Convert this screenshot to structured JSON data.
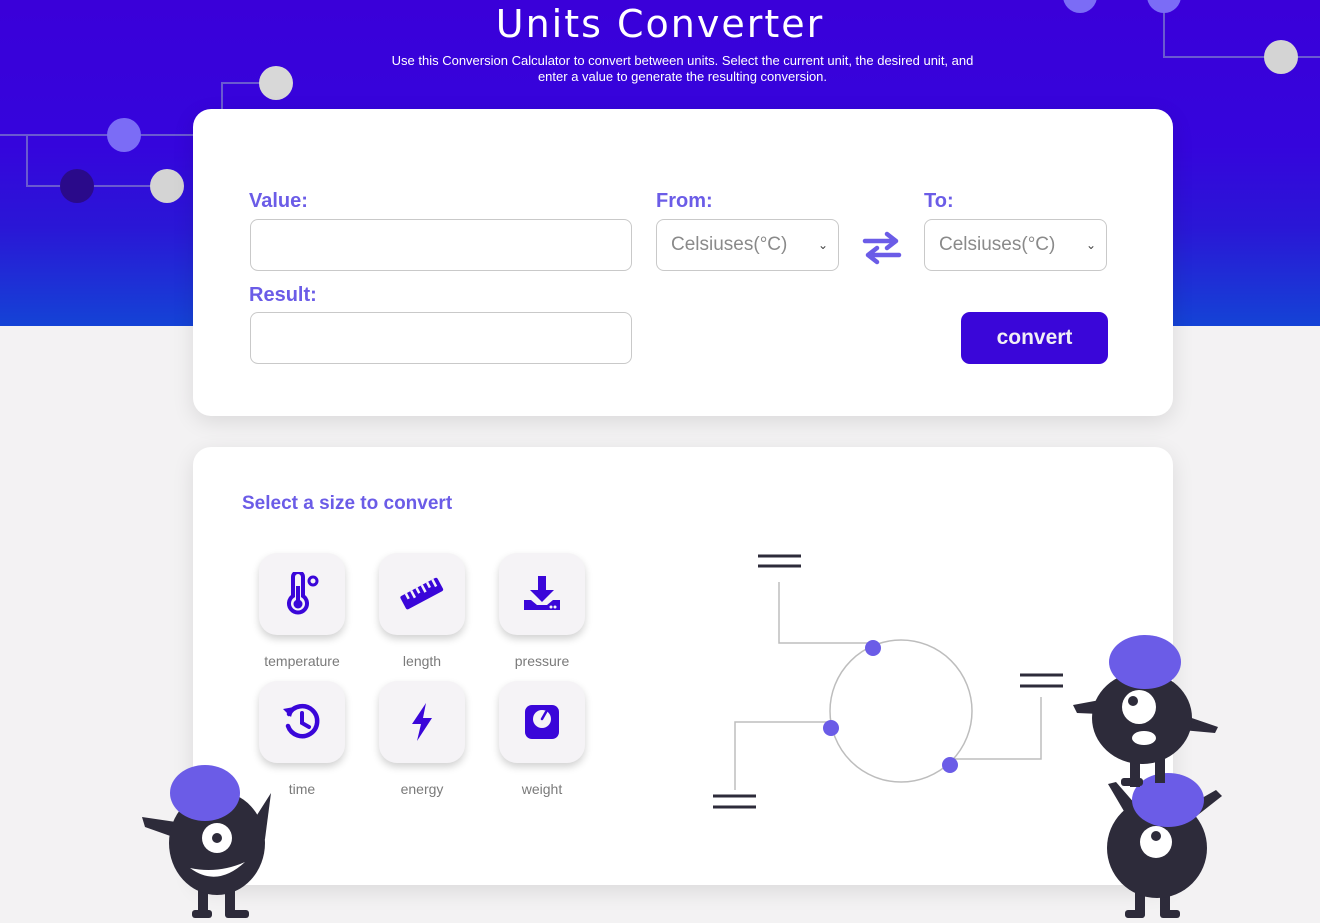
{
  "header": {
    "title": "Units Converter",
    "subtitle": "Use this Conversion Calculator to convert between units. Select the current unit, the desired unit, and enter a value to generate the resulting conversion."
  },
  "converter": {
    "value_label": "Value:",
    "value_input": "",
    "from_label": "From:",
    "from_selected": "Celsiuses(°C)",
    "to_label": "To:",
    "to_selected": "Celsiuses(°C)",
    "result_label": "Result:",
    "result_input": "",
    "convert_label": "convert"
  },
  "categories": {
    "heading": "Select a size to convert",
    "items": [
      {
        "label": "temperature",
        "icon": "thermometer-icon"
      },
      {
        "label": "length",
        "icon": "ruler-icon"
      },
      {
        "label": "pressure",
        "icon": "pressure-download-icon"
      },
      {
        "label": "time",
        "icon": "history-icon"
      },
      {
        "label": "energy",
        "icon": "lightning-icon"
      },
      {
        "label": "weight",
        "icon": "scale-icon"
      }
    ]
  },
  "colors": {
    "brand": "#3a06d9",
    "accent": "#6b5ce7",
    "page_bg": "#f3f2f3"
  }
}
